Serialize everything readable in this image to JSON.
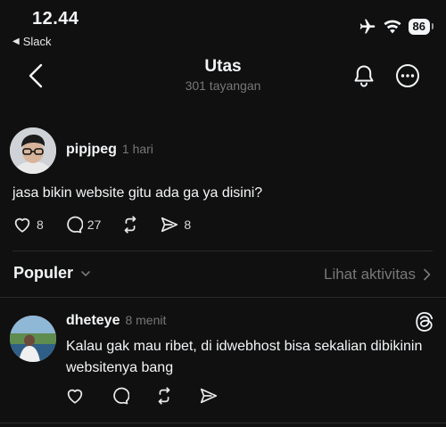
{
  "status_bar": {
    "time": "12.44",
    "back_app": "Slack",
    "battery": "86"
  },
  "header": {
    "title": "Utas",
    "views": "301 tayangan"
  },
  "post": {
    "author": "pipjpeg",
    "time_ago": "1 hari",
    "text": "jasa bikin website gitu ada ga ya disini?",
    "likes": "8",
    "replies": "27",
    "shares": "8"
  },
  "sort": {
    "label": "Populer",
    "activity_label": "Lihat aktivitas"
  },
  "reply": {
    "author": "dheteye",
    "time_ago": "8 menit",
    "text_line1": "Kalau gak mau ribet, di idwebhost bisa sekalian dibikinin",
    "text_line2": "websitenya bang"
  },
  "icons": {
    "back": "chevron-left-icon",
    "notify": "bell-icon",
    "more": "more-icon",
    "like": "heart-icon",
    "reply": "comment-icon",
    "repost": "repost-icon",
    "share": "send-icon",
    "app": "threads-icon"
  }
}
